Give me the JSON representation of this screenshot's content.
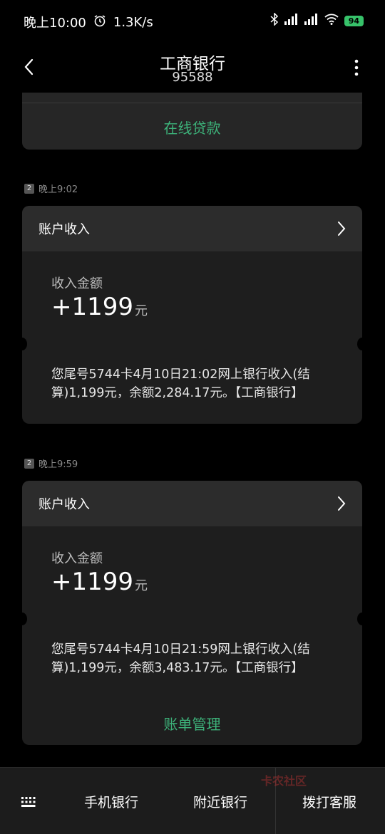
{
  "status_bar": {
    "time": "晚上10:00",
    "speed": "1.3K/s",
    "battery": "94"
  },
  "header": {
    "title": "工商银行",
    "number": "95588"
  },
  "top_card": {
    "link_label": "在线贷款"
  },
  "messages": [
    {
      "sim": "2",
      "time": "晚上9:02",
      "heading": "账户收入",
      "amount_label": "收入金额",
      "amount": "+1199",
      "unit": "元",
      "body": "您尾号5744卡4月10日21:02网上银行收入(结算)1,199元，余额2,284.17元。【工商银行】"
    },
    {
      "sim": "2",
      "time": "晚上9:59",
      "heading": "账户收入",
      "amount_label": "收入金额",
      "amount": "+1199",
      "unit": "元",
      "body": "您尾号5744卡4月10日21:59网上银行收入(结算)1,199元，余额3,483.17元。【工商银行】",
      "link_label": "账单管理"
    }
  ],
  "bottom_bar": {
    "item1": "手机银行",
    "item2": "附近银行",
    "item3": "拨打客服"
  },
  "watermark": "卡农社区"
}
